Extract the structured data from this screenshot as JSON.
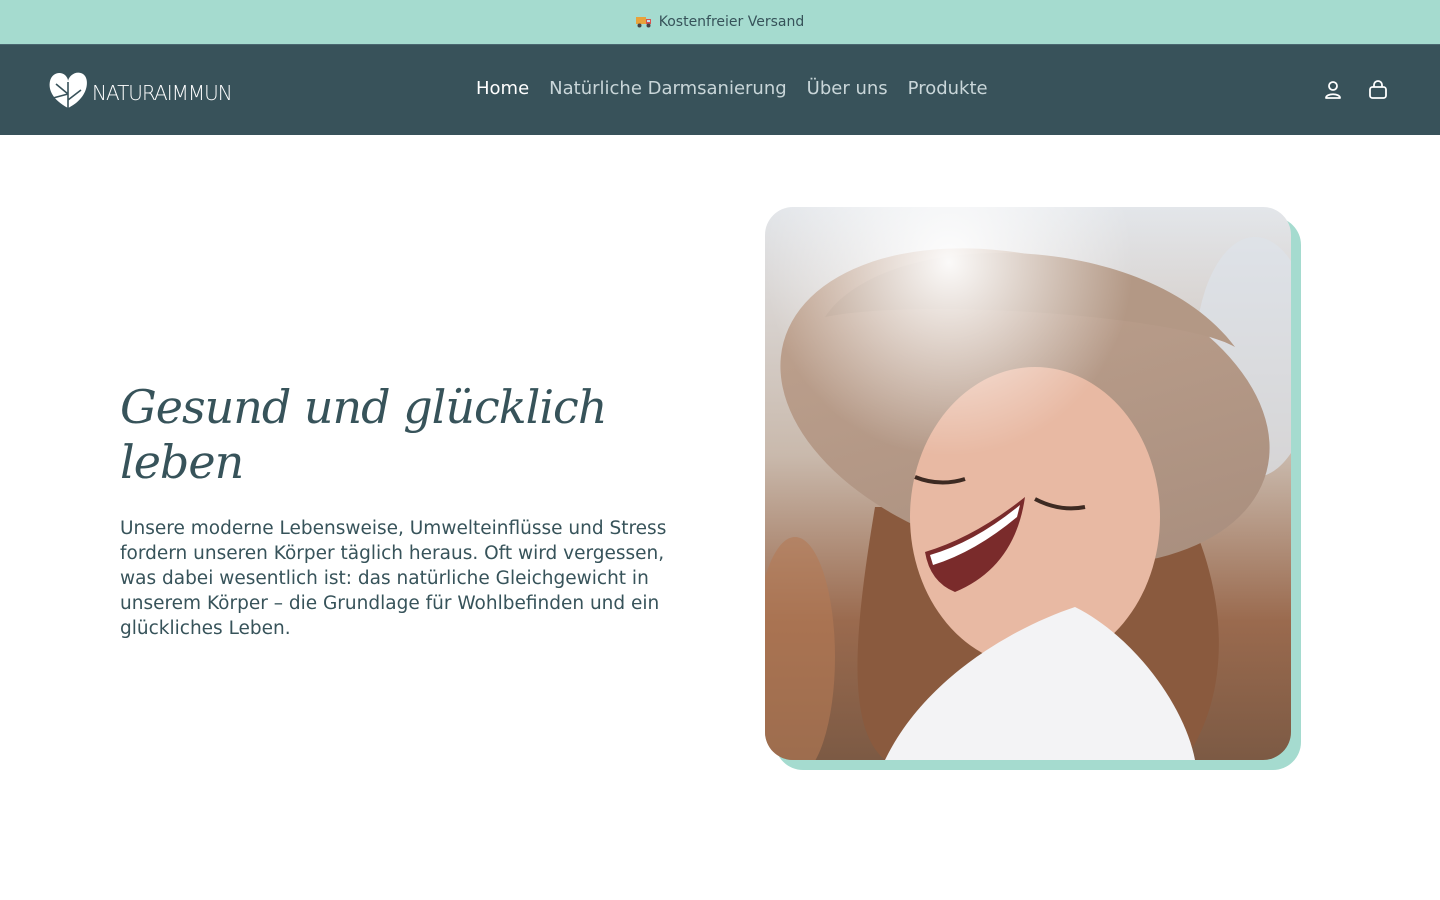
{
  "announcement": {
    "text": "Kostenfreier Versand",
    "icon": "truck-icon"
  },
  "header": {
    "logo_text": "NATURAIMMUN",
    "nav": [
      {
        "label": "Home",
        "active": true
      },
      {
        "label": "Natürliche Darmsanierung",
        "active": false
      },
      {
        "label": "Über uns",
        "active": false
      },
      {
        "label": "Produkte",
        "active": false
      }
    ],
    "icons": [
      "account-icon",
      "cart-icon"
    ]
  },
  "hero": {
    "title": "Gesund und glücklich leben",
    "body": "Unsere moderne Lebensweise, Umwelteinflüsse und Stress fordern unseren Körper täglich heraus. Oft wird vergessen, was dabei wesentlich ist: das natürliche Gleichgewicht in unserem Körper – die Grundlage für Wohlbefinden und ein glückliches Leben."
  },
  "colors": {
    "announcement_bg": "#a5dbcf",
    "header_bg": "#38525a",
    "text": "#37535a",
    "accent": "#a5dbcf"
  }
}
